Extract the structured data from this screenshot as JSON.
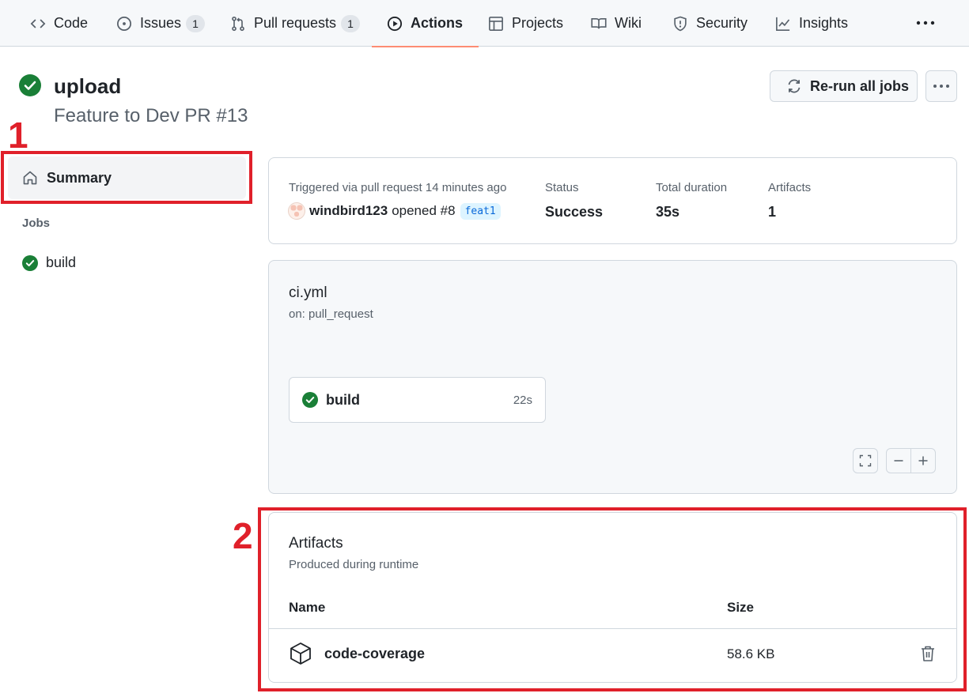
{
  "nav": {
    "tabs": [
      {
        "label": "Code",
        "icon": "code-icon"
      },
      {
        "label": "Issues",
        "icon": "issue-opened-icon",
        "count": "1"
      },
      {
        "label": "Pull requests",
        "icon": "git-pull-request-icon",
        "count": "1"
      },
      {
        "label": "Actions",
        "icon": "play-icon",
        "active": true
      },
      {
        "label": "Projects",
        "icon": "table-icon"
      },
      {
        "label": "Wiki",
        "icon": "book-icon"
      },
      {
        "label": "Security",
        "icon": "shield-icon"
      },
      {
        "label": "Insights",
        "icon": "graph-icon"
      }
    ],
    "more_icon": "kebab-horizontal-icon"
  },
  "run": {
    "title": "upload",
    "subtitle": "Feature to Dev PR #13",
    "rerun_label": "Re-run all jobs"
  },
  "annotations": {
    "one": "1",
    "two": "2",
    "color": "#e0202a"
  },
  "sidebar": {
    "summary_label": "Summary",
    "jobs_heading": "Jobs",
    "jobs": [
      {
        "label": "build",
        "status": "success"
      }
    ]
  },
  "summary": {
    "trigger_text": "Triggered via pull request 14 minutes ago",
    "actor": "windbird123",
    "action": "opened #8",
    "branch": "feat1",
    "status_label": "Status",
    "status_value": "Success",
    "duration_label": "Total duration",
    "duration_value": "35s",
    "artifacts_label": "Artifacts",
    "artifacts_value": "1"
  },
  "workflow": {
    "file": "ci.yml",
    "trigger": "on: pull_request",
    "job_name": "build",
    "job_duration": "22s"
  },
  "artifacts": {
    "title": "Artifacts",
    "subtitle": "Produced during runtime",
    "col_name": "Name",
    "col_size": "Size",
    "items": [
      {
        "name": "code-coverage",
        "size": "58.6 KB"
      }
    ]
  },
  "colors": {
    "success": "#1a7f37",
    "accent_underline": "#fd8c73",
    "branch_blue": "#0969da"
  }
}
